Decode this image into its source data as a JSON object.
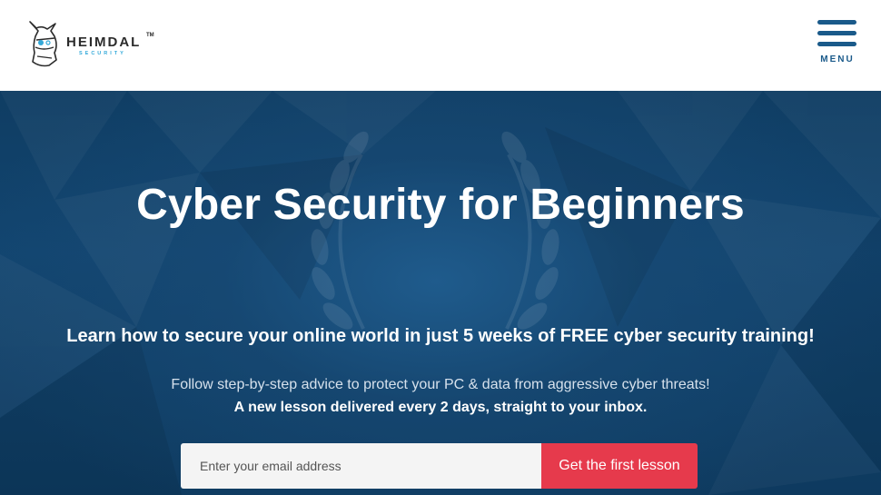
{
  "header": {
    "logo": {
      "name": "HEIMDAL",
      "trademark": "TM",
      "tagline": "SECURITY"
    },
    "menu": {
      "label": "MENU",
      "icon": "hamburger-icon"
    }
  },
  "hero": {
    "title": "Cyber Security for Beginners",
    "subtitle": "Learn how to secure your online world in just 5 weeks of FREE cyber security training!",
    "description": "Follow step-by-step advice to protect your PC & data from aggressive cyber threats!",
    "description_bold": "A new lesson delivered every 2 days, straight to your inbox.",
    "background_icon": "laurel-wreath-icon"
  },
  "signup": {
    "email_placeholder": "Enter your email address",
    "email_value": "",
    "button_label": "Get the first lesson"
  },
  "colors": {
    "brand_blue": "#1a5a8a",
    "accent_cyan": "#33a9d9",
    "cta_red": "#e63a4c",
    "hero_dark": "#0f3d63"
  }
}
